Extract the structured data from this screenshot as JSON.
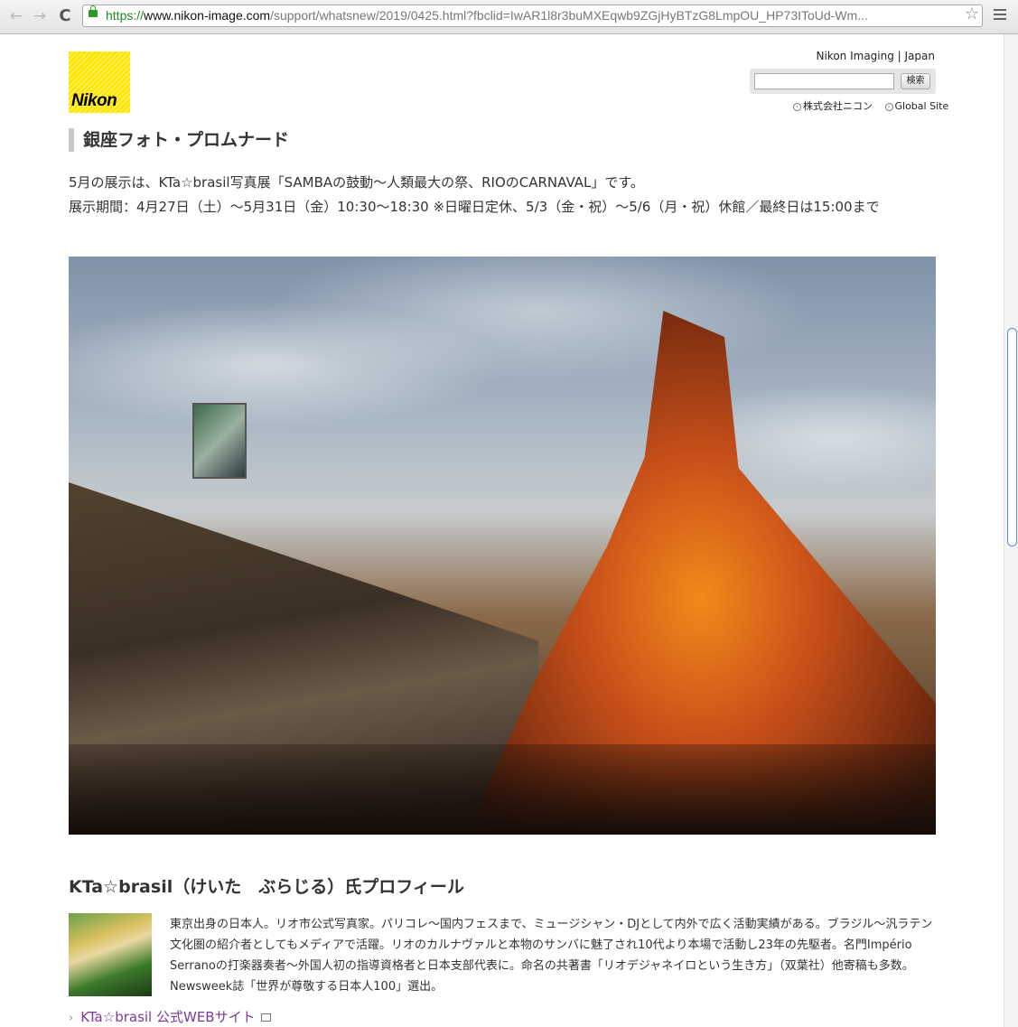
{
  "browser": {
    "url_scheme": "https://",
    "url_host": "www.nikon-image.com",
    "url_path": "/support/whatsnew/2019/0425.html?fbclid=IwAR1l8r3buMXEqwb9ZGjHyBTzG8LmpOU_HP73IToUd-Wm...",
    "back_icon": "←",
    "forward_icon": "→",
    "reload_icon": "C",
    "star_icon": "☆"
  },
  "header": {
    "logo_text": "Nikon",
    "site_label": "Nikon Imaging",
    "region_label": "Japan",
    "search_placeholder": "",
    "search_button": "検索",
    "link_corp": "株式会社ニコン",
    "link_global": "Global Site"
  },
  "main": {
    "heading": "銀座フォト・プロムナード",
    "intro_line1": "5月の展示は、KTa☆brasil写真展「SAMBAの鼓動〜人類最大の祭、RIOのCARNAVAL」です。",
    "intro_line2": "展示期間：4月27日（土）〜5月31日（金）10:30〜18:30 ※日曜日定休、5/3（金・祝）〜5/6（月・祝）休館／最終日は15:00まで"
  },
  "profile": {
    "title": "KTa☆brasil（けいた　ぶらじる）氏プロフィール",
    "text": "東京出身の日本人。リオ市公式写真家。パリコレ〜国内フェスまで、ミュージシャン・DJとして内外で広く活動実績がある。ブラジル〜汎ラテン文化圏の紹介者としてもメディアで活躍。リオのカルナヴァルと本物のサンバに魅了され10代より本場で活動し23年の先駆者。名門Império Serranoの打楽器奏者〜外国人初の指導資格者と日本支部代表に。命名の共著書「リオデジャネイロという生き方」（双葉社）他寄稿も多数。Newsweek誌「世界が尊敬する日本人100」選出。",
    "link_label": "KTa☆brasil 公式WEBサイト",
    "link_chevron": "›"
  }
}
